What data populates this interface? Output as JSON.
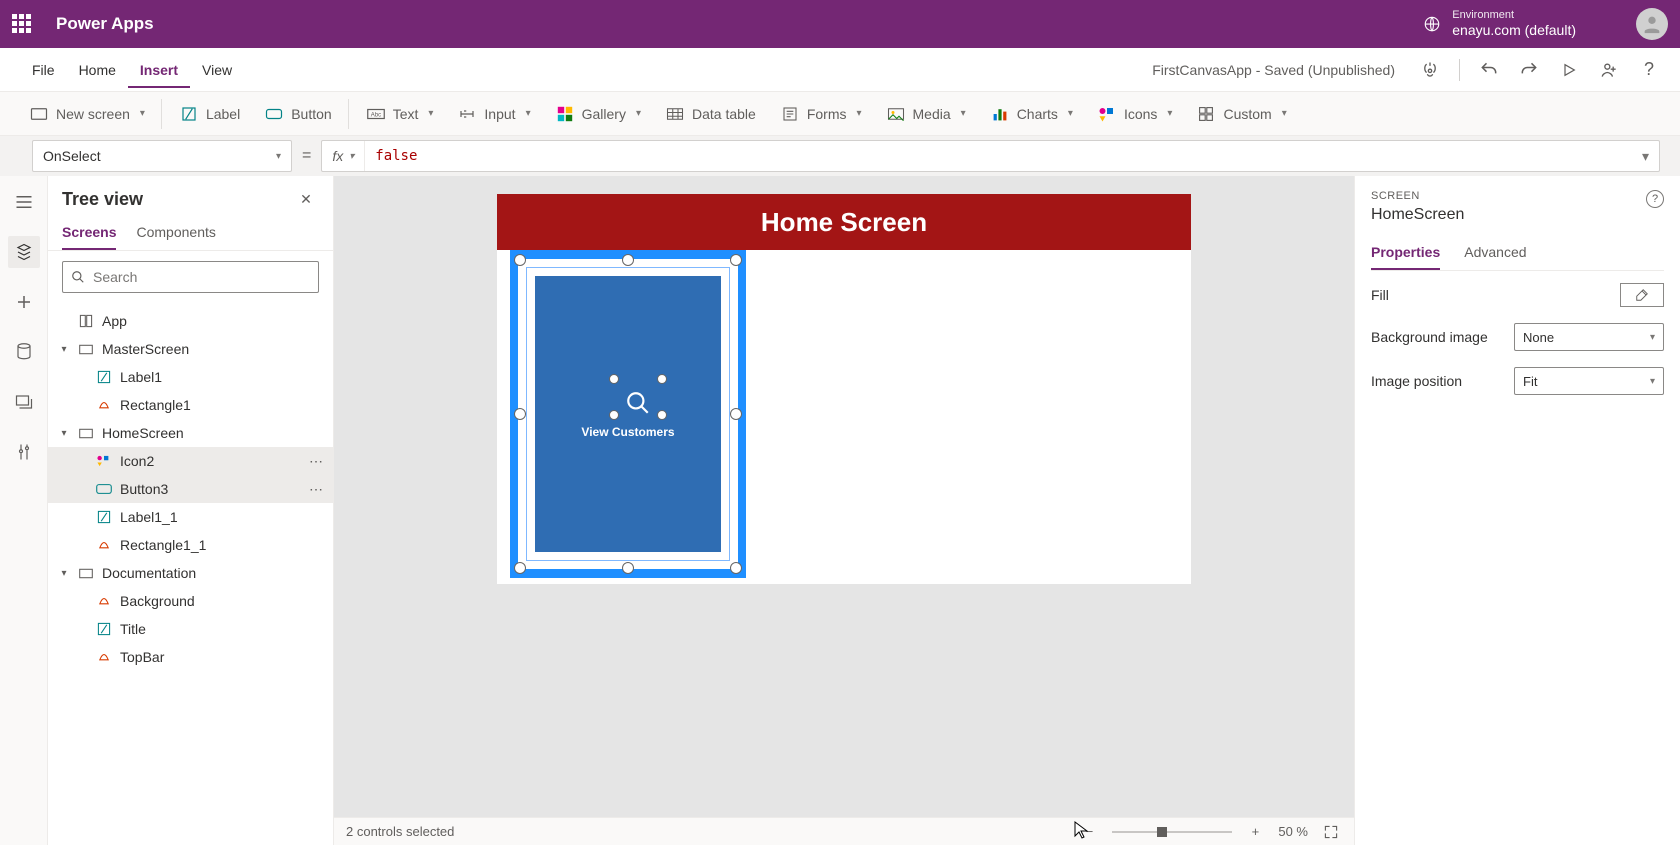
{
  "brand": "Power Apps",
  "environment": {
    "label": "Environment",
    "name": "enayu.com (default)"
  },
  "menu": {
    "file": "File",
    "home": "Home",
    "insert": "Insert",
    "view": "View"
  },
  "docTitle": "FirstCanvasApp - Saved (Unpublished)",
  "ribbon": {
    "newScreen": "New screen",
    "label": "Label",
    "button": "Button",
    "text": "Text",
    "input": "Input",
    "gallery": "Gallery",
    "dataTable": "Data table",
    "forms": "Forms",
    "media": "Media",
    "charts": "Charts",
    "icons": "Icons",
    "custom": "Custom"
  },
  "formula": {
    "property": "OnSelect",
    "value": "false"
  },
  "tree": {
    "title": "Tree view",
    "tabs": {
      "screens": "Screens",
      "components": "Components"
    },
    "searchPlaceholder": "Search",
    "nodes": {
      "app": "App",
      "master": "MasterScreen",
      "label1": "Label1",
      "rectangle1": "Rectangle1",
      "home": "HomeScreen",
      "icon2": "Icon2",
      "button3": "Button3",
      "label1_1": "Label1_1",
      "rectangle1_1": "Rectangle1_1",
      "documentation": "Documentation",
      "background": "Background",
      "titleNode": "Title",
      "topbar": "TopBar"
    }
  },
  "canvas": {
    "headerText": "Home Screen",
    "buttonText": "View Customers"
  },
  "status": {
    "selection": "2 controls selected",
    "zoom": "50  %"
  },
  "props": {
    "caption": "SCREEN",
    "name": "HomeScreen",
    "tabs": {
      "properties": "Properties",
      "advanced": "Advanced"
    },
    "fill": "Fill",
    "bgImage": "Background image",
    "bgImageVal": "None",
    "imgPos": "Image position",
    "imgPosVal": "Fit"
  }
}
